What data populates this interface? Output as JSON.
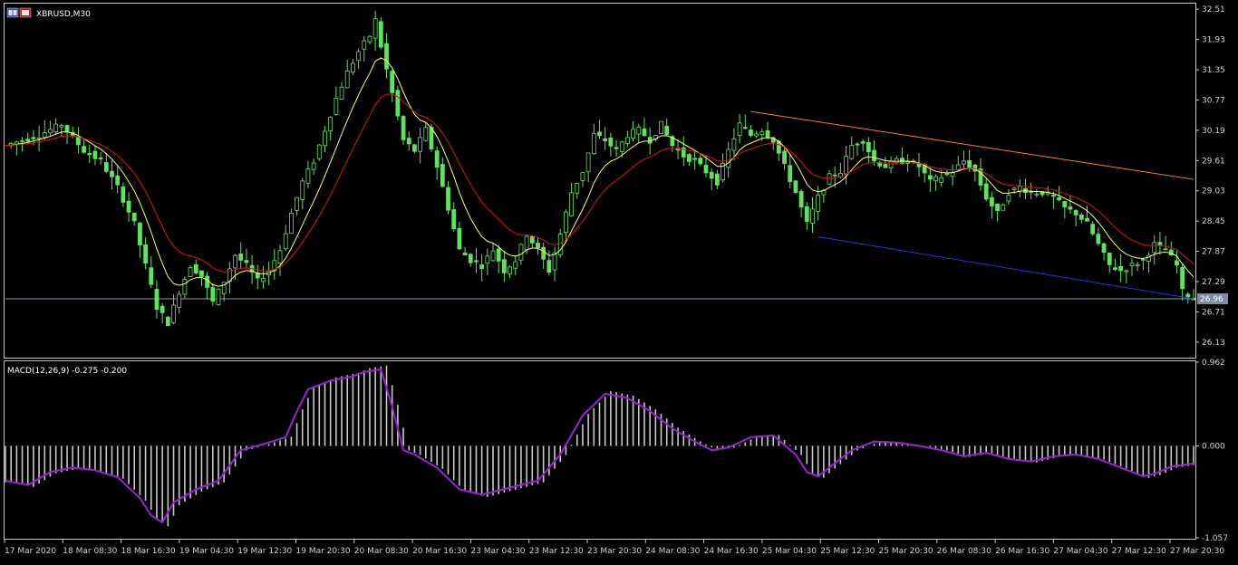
{
  "window": {
    "symbol_label": "XBRUSD,M30",
    "icon": "chart-window-icon"
  },
  "indicator": {
    "macd_label": "MACD(12,26,9) -0.275 -0.200"
  },
  "current_price": "26.96",
  "colors": {
    "background": "#000000",
    "frame": "#c8c8c8",
    "candle": "#5fe35f",
    "ma_fast": "#ffff66",
    "ma_slow": "#e01010",
    "macd_hist": "#c8c8c8",
    "macd_signal": "#9b1fd4",
    "upper_trend": "#ff7b1a",
    "lower_trend": "#2233ee",
    "price_line": "#8a9aae"
  },
  "chart_data": [
    {
      "type": "candlestick",
      "panel": "price",
      "symbol": "XBRUSD",
      "timeframe": "M30",
      "ylim": [
        25.85,
        32.6
      ],
      "yticks": [
        "32.51",
        "31.93",
        "31.35",
        "30.77",
        "30.19",
        "29.61",
        "29.03",
        "28.45",
        "27.87",
        "27.29",
        "26.71",
        "26.13"
      ],
      "xticks": [
        "17 Mar 2020",
        "18 Mar 08:30",
        "18 Mar 16:30",
        "19 Mar 04:30",
        "19 Mar 12:30",
        "19 Mar 20:30",
        "20 Mar 08:30",
        "20 Mar 16:30",
        "23 Mar 04:30",
        "23 Mar 12:30",
        "23 Mar 20:30",
        "24 Mar 08:30",
        "24 Mar 16:30",
        "25 Mar 04:30",
        "25 Mar 12:30",
        "25 Mar 20:30",
        "26 Mar 08:30",
        "26 Mar 16:30",
        "27 Mar 04:30",
        "27 Mar 12:30",
        "27 Mar 20:30"
      ],
      "close_path": [
        [
          0,
          29.9
        ],
        [
          6,
          30.1
        ],
        [
          10,
          30.3
        ],
        [
          14,
          29.8
        ],
        [
          17,
          29.6
        ],
        [
          20,
          29.1
        ],
        [
          23,
          28.4
        ],
        [
          25,
          27.6
        ],
        [
          27,
          26.8
        ],
        [
          29,
          26.5
        ],
        [
          31,
          27.1
        ],
        [
          33,
          27.6
        ],
        [
          35,
          27.4
        ],
        [
          37,
          26.9
        ],
        [
          39,
          27.3
        ],
        [
          41,
          27.8
        ],
        [
          43,
          27.6
        ],
        [
          45,
          27.3
        ],
        [
          47,
          27.5
        ],
        [
          49,
          27.9
        ],
        [
          51,
          28.6
        ],
        [
          53,
          29.2
        ],
        [
          55,
          29.6
        ],
        [
          57,
          30.2
        ],
        [
          59,
          30.8
        ],
        [
          61,
          31.3
        ],
        [
          63,
          31.7
        ],
        [
          65,
          32.0
        ],
        [
          66,
          32.3
        ],
        [
          67,
          31.8
        ],
        [
          69,
          30.9
        ],
        [
          71,
          30.0
        ],
        [
          73,
          29.8
        ],
        [
          75,
          30.2
        ],
        [
          77,
          29.5
        ],
        [
          79,
          28.7
        ],
        [
          81,
          27.9
        ],
        [
          83,
          27.7
        ],
        [
          85,
          27.6
        ],
        [
          87,
          27.9
        ],
        [
          89,
          27.5
        ],
        [
          91,
          27.7
        ],
        [
          93,
          28.2
        ],
        [
          95,
          27.9
        ],
        [
          97,
          27.5
        ],
        [
          99,
          28.2
        ],
        [
          101,
          29.0
        ],
        [
          103,
          29.4
        ],
        [
          105,
          30.1
        ],
        [
          107,
          30.0
        ],
        [
          109,
          29.8
        ],
        [
          111,
          30.1
        ],
        [
          113,
          30.2
        ],
        [
          115,
          30.0
        ],
        [
          117,
          30.3
        ],
        [
          119,
          29.9
        ],
        [
          121,
          29.7
        ],
        [
          123,
          29.6
        ],
        [
          125,
          29.4
        ],
        [
          127,
          29.2
        ],
        [
          129,
          29.8
        ],
        [
          131,
          30.3
        ],
        [
          133,
          30.1
        ],
        [
          135,
          30.2
        ],
        [
          137,
          30.0
        ],
        [
          139,
          29.5
        ],
        [
          141,
          29.0
        ],
        [
          143,
          28.4
        ],
        [
          145,
          28.9
        ],
        [
          147,
          29.3
        ],
        [
          149,
          29.4
        ],
        [
          151,
          29.9
        ],
        [
          153,
          30.0
        ],
        [
          155,
          29.6
        ],
        [
          157,
          29.5
        ],
        [
          159,
          29.6
        ],
        [
          161,
          29.6
        ],
        [
          163,
          29.5
        ],
        [
          165,
          29.2
        ],
        [
          167,
          29.3
        ],
        [
          169,
          29.4
        ],
        [
          171,
          29.6
        ],
        [
          173,
          29.4
        ],
        [
          175,
          28.9
        ],
        [
          177,
          28.6
        ],
        [
          179,
          29.0
        ],
        [
          181,
          29.1
        ],
        [
          183,
          29.0
        ],
        [
          185,
          29.0
        ],
        [
          187,
          28.9
        ],
        [
          189,
          28.7
        ],
        [
          191,
          28.6
        ],
        [
          193,
          28.4
        ],
        [
          195,
          28.0
        ],
        [
          197,
          27.6
        ],
        [
          199,
          27.5
        ],
        [
          201,
          27.6
        ],
        [
          203,
          27.7
        ],
        [
          205,
          28.0
        ],
        [
          207,
          27.9
        ],
        [
          209,
          27.6
        ],
        [
          210,
          27.1
        ],
        [
          212,
          26.96
        ]
      ],
      "series": [
        {
          "name": "MA fast",
          "color": "#ffff66"
        },
        {
          "name": "MA slow",
          "color": "#e01010"
        }
      ],
      "trendlines": [
        {
          "color": "#ff7b1a",
          "from": [
            133,
            30.55
          ],
          "to": [
            212,
            29.25
          ]
        },
        {
          "color": "#2233ee",
          "from": [
            145,
            28.15
          ],
          "to": [
            212,
            26.96
          ]
        }
      ],
      "hline": 26.96
    },
    {
      "type": "macd",
      "panel": "indicator",
      "title": "MACD(12,26,9) -0.275 -0.200",
      "ylim": [
        -1.057,
        0.962
      ],
      "yticks": [
        "0.962",
        "0.000",
        "-1.057"
      ],
      "macd_path": [
        [
          0,
          -0.4
        ],
        [
          4,
          -0.45
        ],
        [
          8,
          -0.3
        ],
        [
          12,
          -0.25
        ],
        [
          16,
          -0.28
        ],
        [
          20,
          -0.36
        ],
        [
          24,
          -0.6
        ],
        [
          26,
          -0.8
        ],
        [
          28,
          -0.88
        ],
        [
          30,
          -0.65
        ],
        [
          34,
          -0.5
        ],
        [
          38,
          -0.4
        ],
        [
          42,
          -0.05
        ],
        [
          46,
          0.02
        ],
        [
          50,
          0.1
        ],
        [
          52,
          0.4
        ],
        [
          54,
          0.65
        ],
        [
          58,
          0.75
        ],
        [
          62,
          0.8
        ],
        [
          64,
          0.85
        ],
        [
          67,
          0.88
        ],
        [
          69,
          0.45
        ],
        [
          71,
          -0.05
        ],
        [
          73,
          -0.1
        ],
        [
          77,
          -0.25
        ],
        [
          81,
          -0.5
        ],
        [
          85,
          -0.56
        ],
        [
          90,
          -0.48
        ],
        [
          95,
          -0.4
        ],
        [
          99,
          -0.1
        ],
        [
          103,
          0.35
        ],
        [
          107,
          0.6
        ],
        [
          111,
          0.55
        ],
        [
          115,
          0.4
        ],
        [
          119,
          0.2
        ],
        [
          123,
          0.05
        ],
        [
          126,
          -0.05
        ],
        [
          129,
          -0.02
        ],
        [
          133,
          0.1
        ],
        [
          137,
          0.12
        ],
        [
          141,
          -0.1
        ],
        [
          143,
          -0.3
        ],
        [
          145,
          -0.35
        ],
        [
          148,
          -0.2
        ],
        [
          151,
          -0.05
        ],
        [
          155,
          0.05
        ],
        [
          159,
          0.04
        ],
        [
          163,
          0.0
        ],
        [
          167,
          -0.05
        ],
        [
          171,
          -0.12
        ],
        [
          175,
          -0.08
        ],
        [
          179,
          -0.15
        ],
        [
          183,
          -0.18
        ],
        [
          187,
          -0.12
        ],
        [
          191,
          -0.1
        ],
        [
          195,
          -0.15
        ],
        [
          199,
          -0.25
        ],
        [
          203,
          -0.35
        ],
        [
          205,
          -0.32
        ],
        [
          208,
          -0.24
        ],
        [
          212,
          -0.2
        ]
      ]
    }
  ]
}
